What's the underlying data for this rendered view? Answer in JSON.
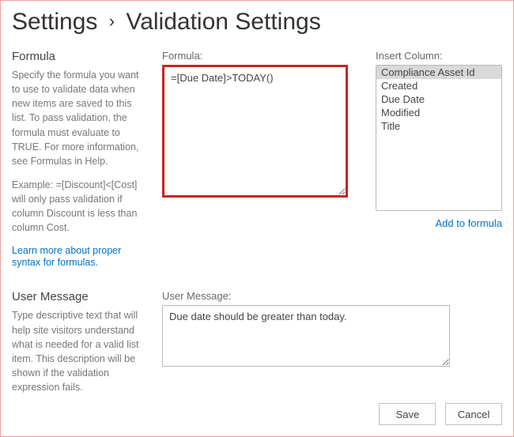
{
  "breadcrumb": {
    "settings_label": "Settings",
    "page_title": "Validation Settings"
  },
  "formula_section": {
    "heading": "Formula",
    "description1": "Specify the formula you want to use to validate data when new items are saved to this list. To pass validation, the formula must evaluate to TRUE. For more information, see Formulas in Help.",
    "description2": "Example: =[Discount]<[Cost] will only pass validation if column Discount is less than column Cost.",
    "learn_more": "Learn more about proper syntax for formulas.",
    "formula_label": "Formula:",
    "formula_value": "=[Due Date]>TODAY()",
    "insert_column_label": "Insert Column:",
    "columns": [
      "Compliance Asset Id",
      "Created",
      "Due Date",
      "Modified",
      "Title"
    ],
    "selected_column_index": 0,
    "add_to_formula": "Add to formula"
  },
  "user_message_section": {
    "heading": "User Message",
    "description": "Type descriptive text that will help site visitors understand what is needed for a valid list item. This description will be shown if the validation expression fails.",
    "label": "User Message:",
    "value": "Due date should be greater than today."
  },
  "buttons": {
    "save": "Save",
    "cancel": "Cancel"
  }
}
